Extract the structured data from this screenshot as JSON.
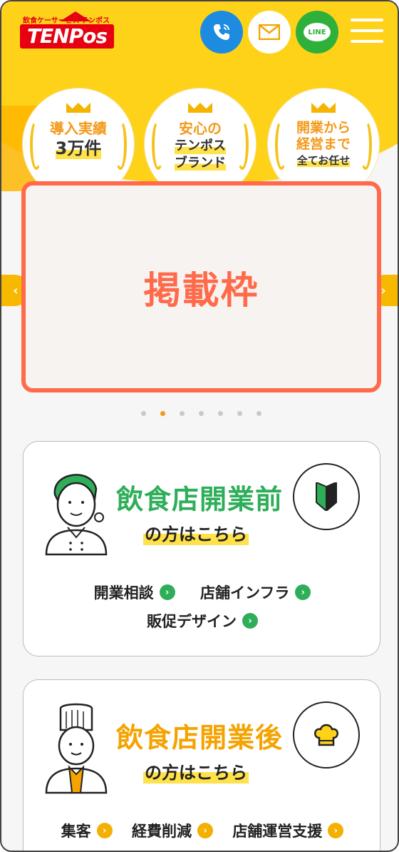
{
  "header": {
    "logo_small_left": "飲食ケーサービス",
    "logo_small_right": "テンポス",
    "logo_text": "TENPos",
    "line_label": "LINE"
  },
  "badges": [
    {
      "line1": "導入実績",
      "line2": "3万件"
    },
    {
      "line1": "安心の",
      "line2": "テンポス",
      "line3": "ブランド"
    },
    {
      "line1": "開業から",
      "line2": "経営まで",
      "line3": "全てお任せ"
    }
  ],
  "banner": {
    "text": "掲載枠"
  },
  "carousel": {
    "dot_count": 7,
    "active_index": 1
  },
  "cards": {
    "before": {
      "title": "飲食店開業前",
      "subtitle": "の方はこちら",
      "links": [
        "開業相談",
        "店舗インフラ",
        "販促デザイン"
      ]
    },
    "after": {
      "title": "飲食店開業後",
      "subtitle": "の方はこちら",
      "links": [
        "集客",
        "経費削減",
        "店舗運営支援"
      ]
    }
  },
  "colors": {
    "brand_yellow": "#ffd21a",
    "brand_red": "#e60012",
    "banner_accent": "#ff6a4a",
    "before_green": "#2fae5a",
    "after_orange": "#f4a300"
  }
}
